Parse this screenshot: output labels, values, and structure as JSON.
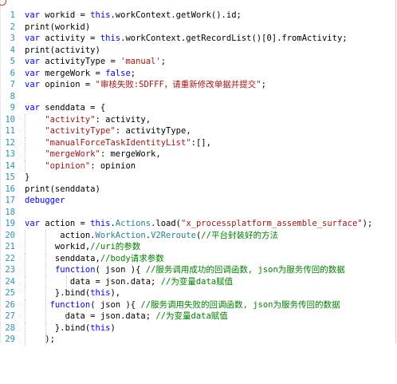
{
  "editor": {
    "lines": [
      {
        "n": "1",
        "indent": 0,
        "tokens": [
          [
            "kw",
            "var"
          ],
          [
            "t",
            " workid = "
          ],
          [
            "kw",
            "this"
          ],
          [
            "t",
            ".workContext.getWork().id;"
          ]
        ]
      },
      {
        "n": "2",
        "indent": 0,
        "tokens": [
          [
            "t",
            "print(workid)"
          ]
        ]
      },
      {
        "n": "3",
        "indent": 0,
        "tokens": [
          [
            "kw",
            "var"
          ],
          [
            "t",
            " activity = "
          ],
          [
            "kw",
            "this"
          ],
          [
            "t",
            ".workContext.getRecordList()[0].fromActivity;"
          ]
        ]
      },
      {
        "n": "4",
        "indent": 0,
        "tokens": [
          [
            "t",
            "print(activity)"
          ]
        ]
      },
      {
        "n": "5",
        "indent": 0,
        "tokens": [
          [
            "kw",
            "var"
          ],
          [
            "t",
            " activityType = "
          ],
          [
            "str",
            "'manual'"
          ],
          [
            "t",
            ";"
          ]
        ]
      },
      {
        "n": "6",
        "indent": 0,
        "tokens": [
          [
            "kw",
            "var"
          ],
          [
            "t",
            " mergeWork = "
          ],
          [
            "kw",
            "false"
          ],
          [
            "t",
            ";"
          ]
        ]
      },
      {
        "n": "7",
        "indent": 0,
        "tokens": [
          [
            "kw",
            "var"
          ],
          [
            "t",
            " opinion = "
          ],
          [
            "str",
            "\"审核失败:SDFFF，请重新修改单据并提交\""
          ],
          [
            "t",
            ";"
          ]
        ]
      },
      {
        "n": "8",
        "indent": 0,
        "tokens": []
      },
      {
        "n": "9",
        "indent": 0,
        "tokens": [
          [
            "kw",
            "var"
          ],
          [
            "t",
            " senddata = {"
          ]
        ]
      },
      {
        "n": "10",
        "indent": 1,
        "tokens": [
          [
            "t",
            "    "
          ],
          [
            "str",
            "\"activity\""
          ],
          [
            "t",
            ": activity,"
          ]
        ]
      },
      {
        "n": "11",
        "indent": 1,
        "tokens": [
          [
            "t",
            "    "
          ],
          [
            "str",
            "\"activityType\""
          ],
          [
            "t",
            ": activityType,"
          ]
        ]
      },
      {
        "n": "12",
        "indent": 1,
        "tokens": [
          [
            "t",
            "    "
          ],
          [
            "str",
            "\"manualForceTaskIdentityList\""
          ],
          [
            "t",
            ":[],"
          ]
        ]
      },
      {
        "n": "13",
        "indent": 1,
        "tokens": [
          [
            "t",
            "    "
          ],
          [
            "str",
            "\"mergeWork\""
          ],
          [
            "t",
            ": mergeWork,"
          ]
        ]
      },
      {
        "n": "14",
        "indent": 1,
        "tokens": [
          [
            "t",
            "    "
          ],
          [
            "str",
            "\"opinion\""
          ],
          [
            "t",
            ": opinion"
          ]
        ]
      },
      {
        "n": "15",
        "indent": 0,
        "tokens": [
          [
            "t",
            "}"
          ]
        ]
      },
      {
        "n": "16",
        "indent": 0,
        "tokens": [
          [
            "t",
            "print(senddata)"
          ]
        ]
      },
      {
        "n": "17",
        "indent": 0,
        "tokens": [
          [
            "kw",
            "debugger"
          ]
        ]
      },
      {
        "n": "18",
        "indent": 0,
        "tokens": []
      },
      {
        "n": "19",
        "indent": 0,
        "tokens": [
          [
            "kw",
            "var"
          ],
          [
            "t",
            " action = "
          ],
          [
            "kw",
            "this"
          ],
          [
            "t",
            "."
          ],
          [
            "special",
            "Actions"
          ],
          [
            "t",
            ".load("
          ],
          [
            "str",
            "\"x_processplatform_assemble_surface\""
          ],
          [
            "t",
            ");"
          ]
        ]
      },
      {
        "n": "20",
        "indent": 2,
        "tokens": [
          [
            "t",
            "       action."
          ],
          [
            "special",
            "WorkAction"
          ],
          [
            "t",
            "."
          ],
          [
            "special",
            "V2Reroute"
          ],
          [
            "t",
            "("
          ],
          [
            "cmt",
            "//平台封装好的方法"
          ]
        ]
      },
      {
        "n": "21",
        "indent": 2,
        "tokens": [
          [
            "t",
            "      workid,"
          ],
          [
            "cmt",
            "//uri的参数"
          ]
        ]
      },
      {
        "n": "22",
        "indent": 2,
        "tokens": [
          [
            "t",
            "      senddata,"
          ],
          [
            "cmt",
            "//body请求参数"
          ]
        ]
      },
      {
        "n": "23",
        "indent": 2,
        "tokens": [
          [
            "t",
            "      "
          ],
          [
            "kw",
            "function"
          ],
          [
            "t",
            "( json ){ "
          ],
          [
            "cmt",
            "//服务调用成功的回调函数, json为服务传回的数据"
          ]
        ]
      },
      {
        "n": "24",
        "indent": 3,
        "tokens": [
          [
            "t",
            "         data = json.data; "
          ],
          [
            "cmt",
            "//为变量data赋值"
          ]
        ]
      },
      {
        "n": "25",
        "indent": 2,
        "tokens": [
          [
            "t",
            "      }.bind("
          ],
          [
            "kw",
            "this"
          ],
          [
            "t",
            "),"
          ]
        ]
      },
      {
        "n": "26",
        "indent": 2,
        "tokens": [
          [
            "t",
            "     "
          ],
          [
            "kw",
            "function"
          ],
          [
            "t",
            "( json ){ "
          ],
          [
            "cmt",
            "//服务调用失败的回调函数, json为服务传回的数据"
          ]
        ]
      },
      {
        "n": "27",
        "indent": 3,
        "tokens": [
          [
            "t",
            "        data = json.data; "
          ],
          [
            "cmt",
            "//为变量data赋值"
          ]
        ]
      },
      {
        "n": "28",
        "indent": 2,
        "tokens": [
          [
            "t",
            "      }.bind("
          ],
          [
            "kw",
            "this"
          ],
          [
            "t",
            ")"
          ]
        ]
      },
      {
        "n": "29",
        "indent": 2,
        "tokens": [
          [
            "t",
            "    );"
          ]
        ]
      }
    ]
  }
}
